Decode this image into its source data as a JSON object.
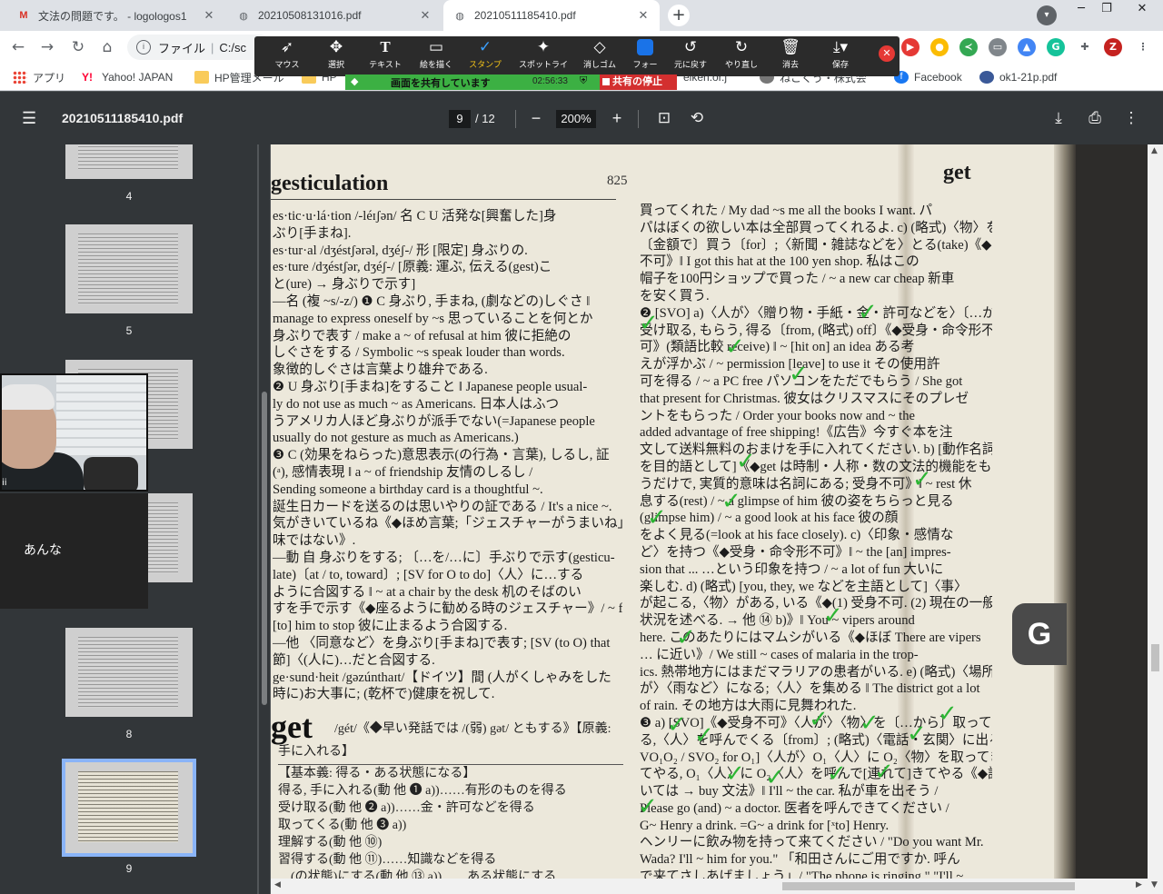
{
  "tabs": [
    {
      "label": "文法の問題です。 - logologos1",
      "favicon": "gmail",
      "active": false
    },
    {
      "label": "20210508131016.pdf",
      "favicon": "globe",
      "active": false
    },
    {
      "label": "20210511185410.pdf",
      "favicon": "globe",
      "active": true
    }
  ],
  "address": {
    "scheme_label": "ファイル",
    "url": "C:/sc"
  },
  "bookmarks": [
    {
      "label": "アプリ"
    },
    {
      "label": "Yahoo! JAPAN"
    },
    {
      "label": "HP管理メール"
    },
    {
      "label": "HP"
    },
    {
      "label": "eiken.or.j"
    },
    {
      "label": "ねこくう・株式会"
    },
    {
      "label": "Facebook"
    },
    {
      "label": "ok1-21p.pdf"
    }
  ],
  "annotation_toolbar": {
    "tools": [
      {
        "label": "マウス",
        "icon": "pointer-icon"
      },
      {
        "label": "選択",
        "icon": "move-icon"
      },
      {
        "label": "テキスト",
        "icon": "text-icon"
      },
      {
        "label": "絵を描く",
        "icon": "rectangle-icon"
      },
      {
        "label": "スタンプ",
        "icon": "check-icon",
        "active": true
      },
      {
        "label": "スポットライ",
        "icon": "spotlight-icon"
      },
      {
        "label": "消しゴム",
        "icon": "eraser-icon"
      },
      {
        "label": "フォー",
        "icon": "color-icon"
      },
      {
        "label": "元に戻す",
        "icon": "undo-icon"
      },
      {
        "label": "やり直し",
        "icon": "redo-icon"
      },
      {
        "label": "消去",
        "icon": "trash-icon"
      },
      {
        "label": "保存",
        "icon": "save-icon"
      }
    ]
  },
  "share_bar": {
    "text": "画面を共有しています",
    "time": "02:56:33",
    "stop_label": "共有の停止"
  },
  "pdf": {
    "title": "20210511185410.pdf",
    "page": "9",
    "total": "/ 12",
    "zoom": "200%"
  },
  "thumbnails": [
    {
      "num": "4"
    },
    {
      "num": "5"
    },
    {
      "num": "6"
    },
    {
      "num": "7"
    },
    {
      "num": "8"
    },
    {
      "num": "9",
      "current": true
    }
  ],
  "video": {
    "name": "ii",
    "chat": "あんな"
  },
  "document": {
    "header_left": "gesticulation",
    "page_number": "825",
    "header_right": "get",
    "side_tab": "G",
    "col1": [
      "es·tic·u·lá·tion /-léɪʃən/ 名 C U 活発な[興奮した]身",
      "ぶり[手まね].",
      "es·tur·al /dʒéstʃərəl, dʒéʃ-/ 形 [限定] 身ぶりの.",
      "es·ture /dʒéstʃər, dʒéʃ-/ [原義: 運ぶ, 伝える(gest)こ",
      "と(ure) → 身ぶりで示す]",
      "―名 (複 ~s/-z/) ❶ C 身ぶり, 手まね, (劇などの)しぐさ ‖",
      "manage to express oneself by ~s 思っていることを何とか",
      "身ぶりで表す / make a ~ of refusal at him 彼に拒絶の",
      "しぐさをする / Symbolic ~s speak louder than words.",
      "象徴的しぐさは言葉より雄弁である.",
      "❷ U 身ぶり[手まね]をすること ‖ Japanese people usual-",
      "ly do not use as much ~ as Americans. 日本人はふつ",
      "うアメリカ人ほど身ぶりが派手でない(=Japanese people",
      "usually do not gesture as much as Americans.)",
      "❸ C (効果をねらった)意思表示(の行為・言葉), しるし, 証",
      "(ᵃ), 感情表現 ‖ a ~ of friendship 友情のしるし /",
      "Sending someone a birthday card is a thoughtful ~.",
      "誕生日カードを送るのは思いやりの証である / It's a nice ~.",
      "気がきいているね《◆ほめ言葉;「ジェスチャーがうまいね」という意",
      "味ではない》.",
      "―動 自 身ぶりをする; 〔…を/…に〕手ぶりで示す(gesticu-",
      "late)〔at / to, toward〕; [SV for O to do]〈人〉に…する",
      "ように合図する ‖ ~ at a chair by the desk 机のそばのい",
      "すを手で示す《◆座るように勧める時のジェスチャー》/ ~ for",
      "[to] him to stop 彼に止まるよう合図する.",
      "―他 〈同意など〉を身ぶり[手まね]で表す; [SV (to O) that",
      "節]〈(人に)…だと合図する.",
      "ge·sund·heit /gəzúnthaɪt/【ドイツ】間 (人がくしゃみをした",
      "時に)お大事に; (乾杯で)健康を祝して."
    ],
    "get_head": "get",
    "get_pron": "/gét/《◆早い発話では /(弱) gət/ ともする》【原義:",
    "get_line2": "手に入れる】",
    "basic": [
      "【基本義: 得る・ある状態になる】",
      "得る, 手に入れる(動 他 ❶ a))……有形のものを得る",
      "受け取る(動 他 ❷ a))……金・許可などを得る",
      "取ってくる(動 他 ❸ a))",
      "理解する(動 他 ⑩)",
      "習得する(動 他 ⑪)……知識などを得る",
      "…(の状態)にする(動 他 ⑬ a))……ある状態にする"
    ],
    "col2": [
      "買ってくれた / My dad ~s me all the books I want. パ",
      "パはぼくの欲しい本は全部買ってくれるよ. c) (略式)〈物〉を",
      "〔金額で〕買う〔for〕;〈新聞・雑誌などを〉とる(take)《◆受身",
      "不可》‖ I got this hat at the 100 yen shop. 私はこの",
      "帽子を100円ショップで買った / ~ a new car cheap 新車",
      "を安く買う.",
      "❷ [SVO] a)〈人が〉〈贈り物・手紙・金・許可などを〉〔…から〕",
      "受け取る, もらう, 得る〔from, (略式) off〕《◆受身・命令形不",
      "可》(類語比較 receive) ‖ ~ [hit on] an idea ある考",
      "えが浮かぶ / ~ permission [leave] to use it その使用許",
      "可を得る / ~ a PC free パソコンをただでもらう / She got",
      "that present for Christmas. 彼女はクリスマスにそのプレゼ",
      "ントをもらった / Order your books now and ~ the",
      "added advantage of free shipping!《広告》今すぐ本を注",
      "文して送料無料のおまけを手に入れてください. b) [動作名詞",
      "を目的語として]《◆get は時制・人称・数の文法的機能をもな",
      "うだけで, 実質的意味は名詞にある; 受身不可》‖ ~ rest 休",
      "息する(rest) / ~ a glimpse of him 彼の姿をちらっと見る",
      "(glimpse him) / ~ a good look at his face 彼の顔",
      "をよく見る(=look at his face closely). c)〈印象・感情な",
      "ど〉を持つ《◆受身・命令形不可》‖ ~ the [an] impres-",
      "sion that ... …という印象を持つ / ~ a lot of fun 大いに",
      "楽しむ. d) (略式) [you, they, we などを主語として]〈事〉",
      "が起こる,〈物〉がある, いる《◆(1) 受身不可. (2) 現在の一般的",
      "状況を述べる. → 他 ⑭ b)》‖ You ~ vipers around",
      "here. このあたりにはマムシがいる《◆ほぼ There are vipers",
      "… に近い》/ We still ~ cases of malaria in the trop-",
      "ics. 熱帯地方にはまだマラリアの患者がいる. e) (略式)〈場所",
      "が〉〈雨など〉になる;〈人〉を集める ‖ The district got a lot",
      "of rain. その地方は大雨に見舞われた.",
      "❸ a) [SVO]《◆受身不可》〈人が〉〈物〉を〔…から〕取ってく",
      "る,〈人〉を呼んでくる〔from〕; (略式)〈電話・玄関〉に出る; [S",
      "VO₁O₂ / SVO₂ for O₁]〈人が〉O₁〈人〉に O₂〈物〉を取ってき",
      "てやる, O₁〈人〉に O₂〈人〉を呼んで[連れて]きてやる《◆語順につ",
      "いては → buy 文法》‖ I'll ~ the car. 私が車を出そう /",
      "Please go (and) ~ a doctor. 医者を呼んできてください /",
      "G~ Henry a drink. =G~ a drink for [ˣto] Henry.",
      "ヘンリーに飲み物を持って来てください / \"Do you want Mr.",
      "Wada? I'll ~ him for you.\" 「和田さんにご用ですか. 呼ん",
      "で来てさしあげましょう」/ \"The phone is ringing.\" \"I'll ~"
    ]
  }
}
